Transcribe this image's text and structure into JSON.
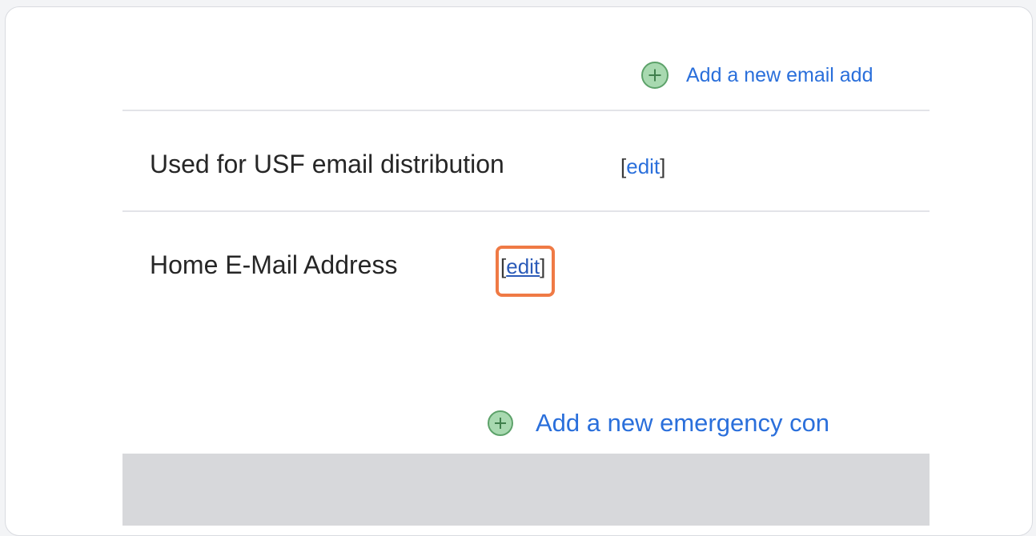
{
  "email_section": {
    "add_email_label": "Add a new email add",
    "rows": [
      {
        "label": "Used for USF email distribution",
        "edit_label": "edit",
        "bracket_open": "[",
        "bracket_close": "]"
      },
      {
        "label": "Home E-Mail Address",
        "edit_label": "edit",
        "bracket_open": "[",
        "bracket_close": "]"
      }
    ]
  },
  "emergency_section": {
    "add_contact_label": "Add a new emergency con"
  },
  "icons": {
    "add_email": "plus-circle-icon",
    "add_contact": "plus-circle-icon"
  },
  "colors": {
    "link": "#2a6fdb",
    "highlight": "#ef7a45",
    "plus_fill": "#a8d9b0"
  }
}
